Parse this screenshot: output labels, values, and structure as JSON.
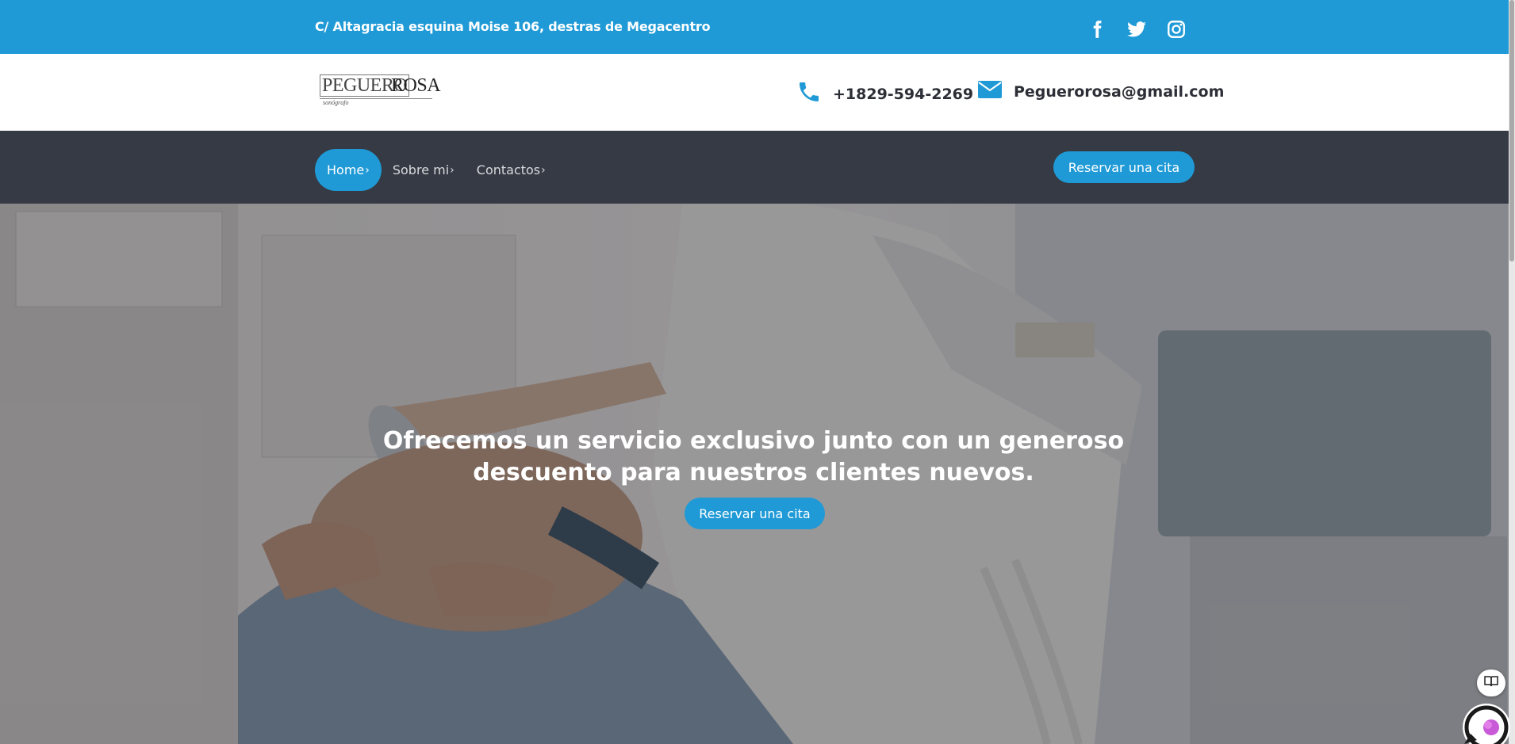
{
  "topbar": {
    "address": "C/ Altagracia esquina Moise 106, destras de Megacentro",
    "socials": [
      "facebook-icon",
      "twitter-icon",
      "instagram-icon"
    ]
  },
  "brand": {
    "logo_word1": "PEGUERO",
    "logo_word2": "ROSA",
    "logo_tagline": "sonógrafo",
    "phone": "+1829-594-2269",
    "email": "Peguerorosa@gmail.com"
  },
  "nav": {
    "items": [
      {
        "label": "Home",
        "active": true
      },
      {
        "label": "Sobre mi",
        "active": false
      },
      {
        "label": "Contactos",
        "active": false
      }
    ],
    "cta_label": "Reservar una cita"
  },
  "hero": {
    "headline": "Ofrecemos un servicio exclusivo junto con un generoso descuento para nuestros clientes nuevos.",
    "cta_label": "Reservar una cita"
  },
  "colors": {
    "accent": "#1f9ad6",
    "navbar": "#353a44",
    "text_dark": "#2c2f36"
  }
}
